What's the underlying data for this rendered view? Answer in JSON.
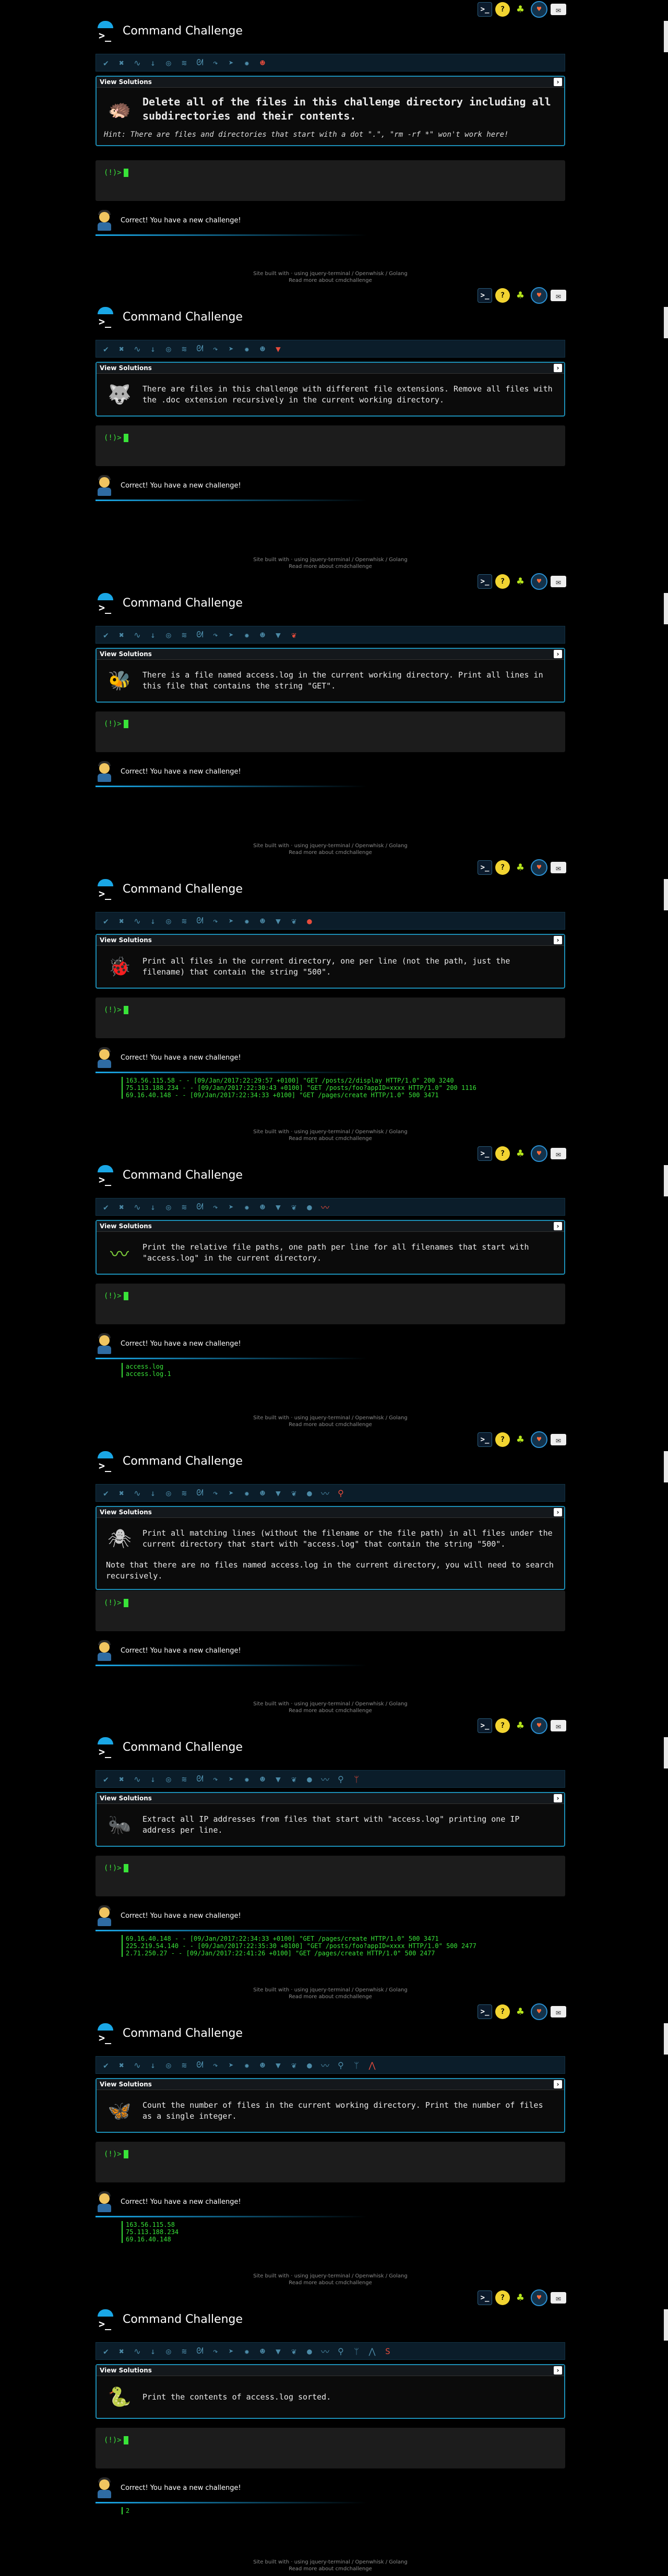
{
  "site_title": "Command Challenge",
  "view_solutions": "View Solutions",
  "prompt": "(!)>",
  "status_text": "Correct! You have a new challenge!",
  "footer": {
    "line1": "Site built with · using jquery-terminal / Openwhisk / Golang",
    "line2": "Read more about cmdchallenge"
  },
  "top_icons": [
    "terminal-icon",
    "question-icon",
    "bell-icon",
    "heart-icon",
    "mail-icon"
  ],
  "colors": {
    "accent": "#1aa7e6",
    "prompt": "#39e339",
    "background": "#000000"
  },
  "frames": [
    {
      "badges": [
        "check",
        "x",
        "snake",
        "down",
        "circle",
        "lizard",
        "dragon",
        "hook",
        "fish",
        "star",
        "face"
      ],
      "challenge_icon": "hedgehog-icon",
      "challenge_text": "Delete all of the files in this challenge directory including all subdirectories and their contents.",
      "big": true,
      "hint": "Hint: There are files and directories that start with a dot \".\", \"rm -rf *\" won't work here!",
      "output": []
    },
    {
      "badges": [
        "check",
        "x",
        "snake",
        "down",
        "circle",
        "lizard",
        "dragon",
        "hook",
        "fish",
        "star",
        "face",
        "wolf"
      ],
      "challenge_icon": "wolf-icon",
      "challenge_text": "There are files in this challenge with different file extensions. Remove all files with the .doc extension recursively in the current working directory.",
      "big": false,
      "hint": "",
      "output": []
    },
    {
      "badges": [
        "check",
        "x",
        "snake",
        "down",
        "circle",
        "lizard",
        "dragon",
        "hook",
        "fish",
        "star",
        "face",
        "wolf",
        "bird"
      ],
      "challenge_icon": "bird-icon",
      "challenge_text": "There is a file named access.log in the current working directory. Print all lines in this file that contains the string \"GET\".",
      "big": false,
      "hint": "",
      "output": []
    },
    {
      "badges": [
        "check",
        "x",
        "snake",
        "down",
        "circle",
        "lizard",
        "dragon",
        "hook",
        "fish",
        "star",
        "face",
        "wolf",
        "bird",
        "beetle"
      ],
      "challenge_icon": "beetle-icon",
      "challenge_text": "Print all files in the current directory, one per line (not the path, just the filename) that contain the string \"500\".",
      "big": false,
      "hint": "",
      "output": [
        "163.56.115.58 - - [09/Jan/2017:22:29:57 +0100] \"GET /posts/2/display HTTP/1.0\" 200 3240",
        "75.113.188.234 - - [09/Jan/2017:22:30:43 +0100] \"GET /posts/foo?appID=xxxx HTTP/1.0\" 200 1116",
        "69.16.40.148 - - [09/Jan/2017:22:34:33 +0100] \"GET /pages/create HTTP/1.0\" 500 3471"
      ]
    },
    {
      "badges": [
        "check",
        "x",
        "snake",
        "down",
        "circle",
        "lizard",
        "dragon",
        "hook",
        "fish",
        "star",
        "face",
        "wolf",
        "bird",
        "beetle",
        "worm"
      ],
      "challenge_icon": "worm-icon",
      "challenge_text": "Print the relative file paths, one path per line for all filenames that start with \"access.log\" in the current directory.",
      "big": false,
      "hint": "",
      "output": [
        "access.log",
        "access.log.1"
      ]
    },
    {
      "badges": [
        "check",
        "x",
        "snake",
        "down",
        "circle",
        "lizard",
        "dragon",
        "hook",
        "fish",
        "star",
        "face",
        "wolf",
        "bird",
        "beetle",
        "worm",
        "spider"
      ],
      "challenge_icon": "spider-icon",
      "challenge_text": "Print all matching lines (without the filename or the file path) in all files under the current directory that start with \"access.log\" that contain the string \"500\".",
      "big": false,
      "note": "Note that there are no files named access.log in the current directory, you will need to search recursively.",
      "hint": "",
      "output": []
    },
    {
      "badges": [
        "check",
        "x",
        "snake",
        "down",
        "circle",
        "lizard",
        "dragon",
        "hook",
        "fish",
        "star",
        "face",
        "wolf",
        "bird",
        "beetle",
        "worm",
        "spider",
        "ant"
      ],
      "challenge_icon": "ant-icon",
      "challenge_text": "Extract all IP addresses from files that start with \"access.log\" printing one IP address per line.",
      "big": false,
      "hint": "",
      "output": [
        "69.16.40.148 - - [09/Jan/2017:22:34:33 +0100] \"GET /pages/create HTTP/1.0\" 500 3471",
        "225.219.54.140 - - [09/Jan/2017:22:35:30 +0100] \"GET /posts/foo?appID=xxxx HTTP/1.0\" 500 2477",
        "2.71.250.27 - - [09/Jan/2017:22:41:26 +0100] \"GET /pages/create HTTP/1.0\" 500 2477"
      ]
    },
    {
      "badges": [
        "check",
        "x",
        "snake",
        "down",
        "circle",
        "lizard",
        "dragon",
        "hook",
        "fish",
        "star",
        "face",
        "wolf",
        "bird",
        "beetle",
        "worm",
        "spider",
        "ant",
        "wings"
      ],
      "challenge_icon": "wings-icon",
      "challenge_text": "Count the number of files in the current working directory. Print the number of files as a single integer.",
      "big": false,
      "hint": "",
      "output": [
        "163.56.115.58",
        "75.113.188.234",
        "69.16.40.148"
      ]
    },
    {
      "badges": [
        "check",
        "x",
        "snake",
        "down",
        "circle",
        "lizard",
        "dragon",
        "hook",
        "fish",
        "star",
        "face",
        "wolf",
        "bird",
        "beetle",
        "worm",
        "spider",
        "ant",
        "wings",
        "serpent"
      ],
      "challenge_icon": "serpent-icon",
      "challenge_text": "Print the contents of access.log sorted.",
      "big": false,
      "hint": "",
      "output": [
        "2"
      ]
    }
  ]
}
